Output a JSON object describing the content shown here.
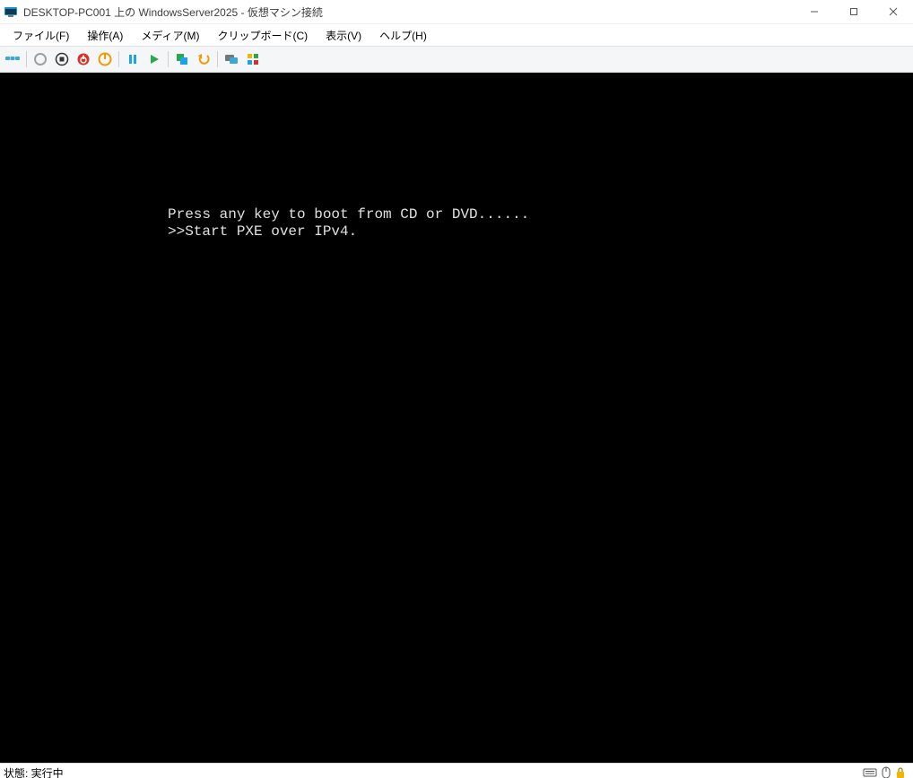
{
  "window": {
    "title": "DESKTOP-PC001 上の WindowsServer2025  - 仮想マシン接続"
  },
  "menu": {
    "file": "ファイル(F)",
    "action": "操作(A)",
    "media": "メディア(M)",
    "clipboard": "クリップボード(C)",
    "view": "表示(V)",
    "help": "ヘルプ(H)"
  },
  "toolbar": {
    "icons": {
      "ctrl_alt_del": "ctrl-alt-del-icon",
      "start_grey": "start-grey-icon",
      "stop_grey": "stop-grey-icon",
      "shutdown": "shutdown-icon",
      "reset": "reset-icon",
      "pause": "pause-icon",
      "play": "play-icon",
      "checkpoint": "checkpoint-icon",
      "revert": "revert-icon",
      "enhanced": "enhanced-icon",
      "share": "share-icon"
    }
  },
  "console": {
    "line1": "Press any key to boot from CD or DVD......",
    "line2": ">>Start PXE over IPv4."
  },
  "statusbar": {
    "label": "状態: 実行中"
  }
}
